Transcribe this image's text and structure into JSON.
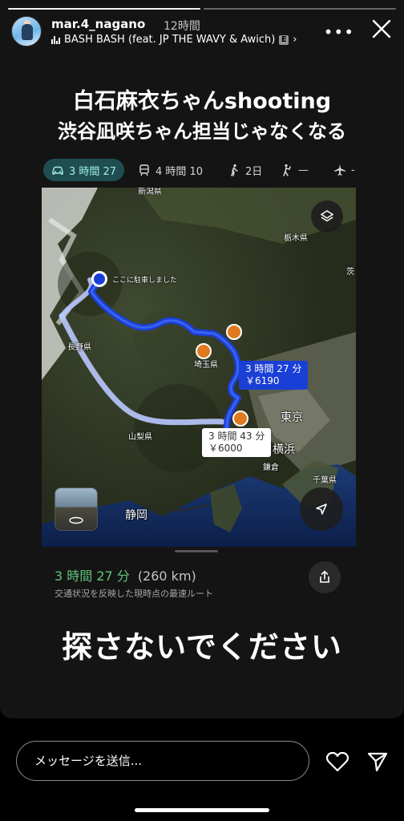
{
  "story": {
    "username": "mar.4_nagano",
    "time": "12時間",
    "music": "BASH BASH (feat. JP THE WAVY & Awich)",
    "explicit_badge": "E",
    "progress": {
      "segments": 2,
      "current": 1
    }
  },
  "caption": {
    "line1": "白石麻衣ちゃんshooting",
    "line2": "渋谷凪咲ちゃん担当じゃなくなる",
    "bottom": "探さないでください"
  },
  "modes": [
    {
      "icon": "car-icon",
      "label": "3 時間 27",
      "active": true
    },
    {
      "icon": "train-icon",
      "label": "4 時間 10",
      "active": false
    },
    {
      "icon": "walk-icon",
      "label": "2日",
      "active": false
    },
    {
      "icon": "rideshare-icon",
      "label": "—",
      "active": false
    },
    {
      "icon": "plane-icon",
      "label": "-",
      "active": false
    }
  ],
  "map": {
    "pin_label": "ここに駐車しました",
    "places": {
      "niigata": "新潟県",
      "tochigi": "栃木県",
      "ibaraki": "茨",
      "nagano": "長野県",
      "saitama": "埼玉県",
      "tokyo": "東京",
      "yamanashi": "山梨県",
      "yokohama": "横浜",
      "kamakura": "鎌倉",
      "chiba": "千葉県",
      "shizuoka": "静岡"
    },
    "route_main": {
      "time": "3 時間 27 分",
      "cost": "￥6190"
    },
    "route_alt": {
      "time": "3 時間 43 分",
      "cost": "￥6000"
    },
    "colors": {
      "route_main": "#1a3fd6",
      "route_alt": "#b9c8ff"
    }
  },
  "summary": {
    "duration": "3 時間 27 分",
    "distance": "(260 km)",
    "note": "交通状況を反映した現時点の最速ルート"
  },
  "footer": {
    "message_placeholder": "メッセージを送信..."
  }
}
